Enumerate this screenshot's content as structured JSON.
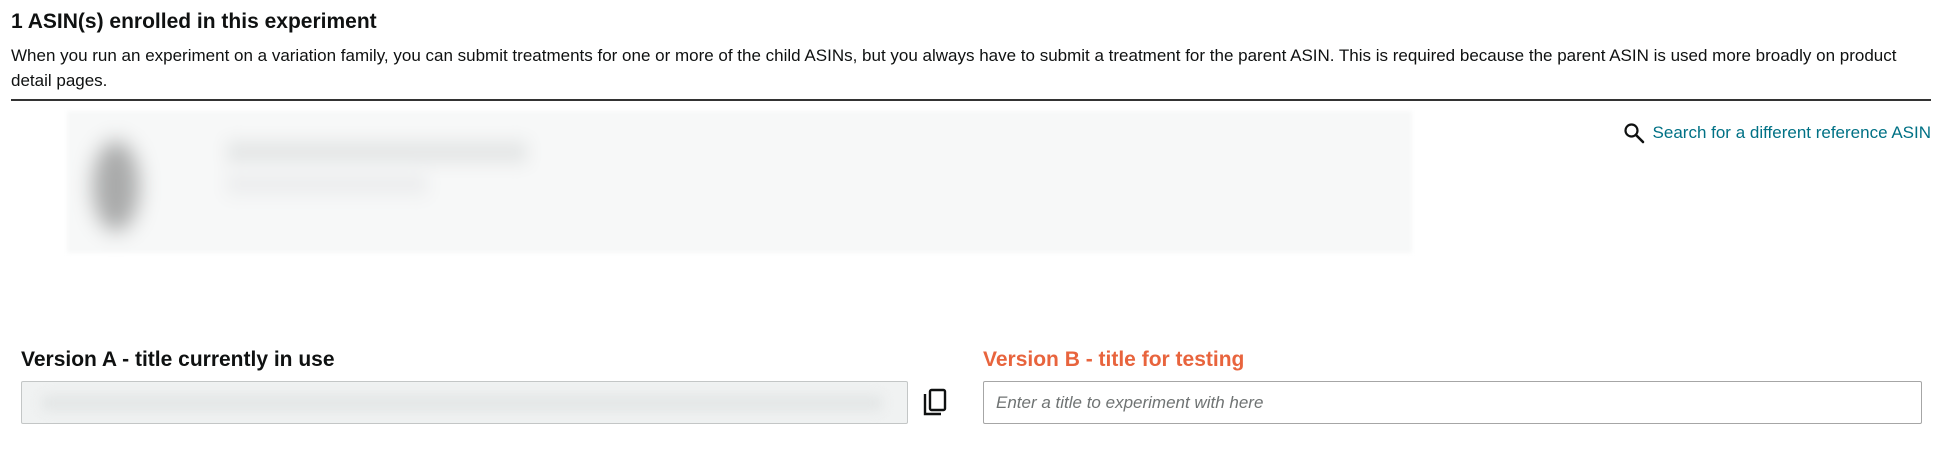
{
  "section": {
    "title": "1 ASIN(s) enrolled in this experiment",
    "description": "When you run an experiment on a variation family, you can submit treatments for one or more of the child ASINs, but you always have to submit a treatment for the parent ASIN. This is required because the parent ASIN is used more broadly on product detail pages."
  },
  "search_link": {
    "icon": "search-icon",
    "label": "Search for a different reference ASIN",
    "color": "#007185"
  },
  "version_a": {
    "label": "Version A - title currently in use",
    "copy_icon": "copy-icon"
  },
  "version_b": {
    "label": "Version B - title for testing",
    "placeholder": "Enter a title to experiment with here",
    "value": "",
    "label_color": "#e8643d"
  }
}
